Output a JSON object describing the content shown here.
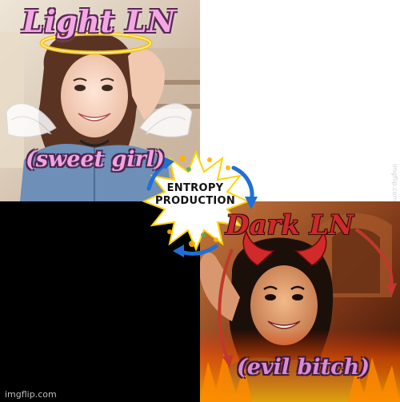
{
  "meme": {
    "light": {
      "title": "Light LN",
      "subtitle": "(sweet girl)"
    },
    "dark": {
      "title": "Dark LN",
      "subtitle": "(evil bitch)"
    },
    "center": {
      "line1": "ENTROPY",
      "line2": "PRODUCTION"
    },
    "watermark": "imgflip.com",
    "side_watermark": "imgflip.com"
  },
  "colors": {
    "light_text": "#f3a8e4",
    "dark_text": "#cc2a2a",
    "halo": "#f5c21a",
    "arrow_blue": "#1f6fd6",
    "arrow_red": "#c0392b",
    "burst_yellow": "#ffe94a",
    "bottom_left_fill": "#000000"
  },
  "icons": {
    "halo": "halo-icon",
    "wings": "angel-wings-icon",
    "horns": "devil-horns-icon",
    "cycle_arrows": "cycle-arrows-icon",
    "explosion": "explosion-burst-icon"
  }
}
